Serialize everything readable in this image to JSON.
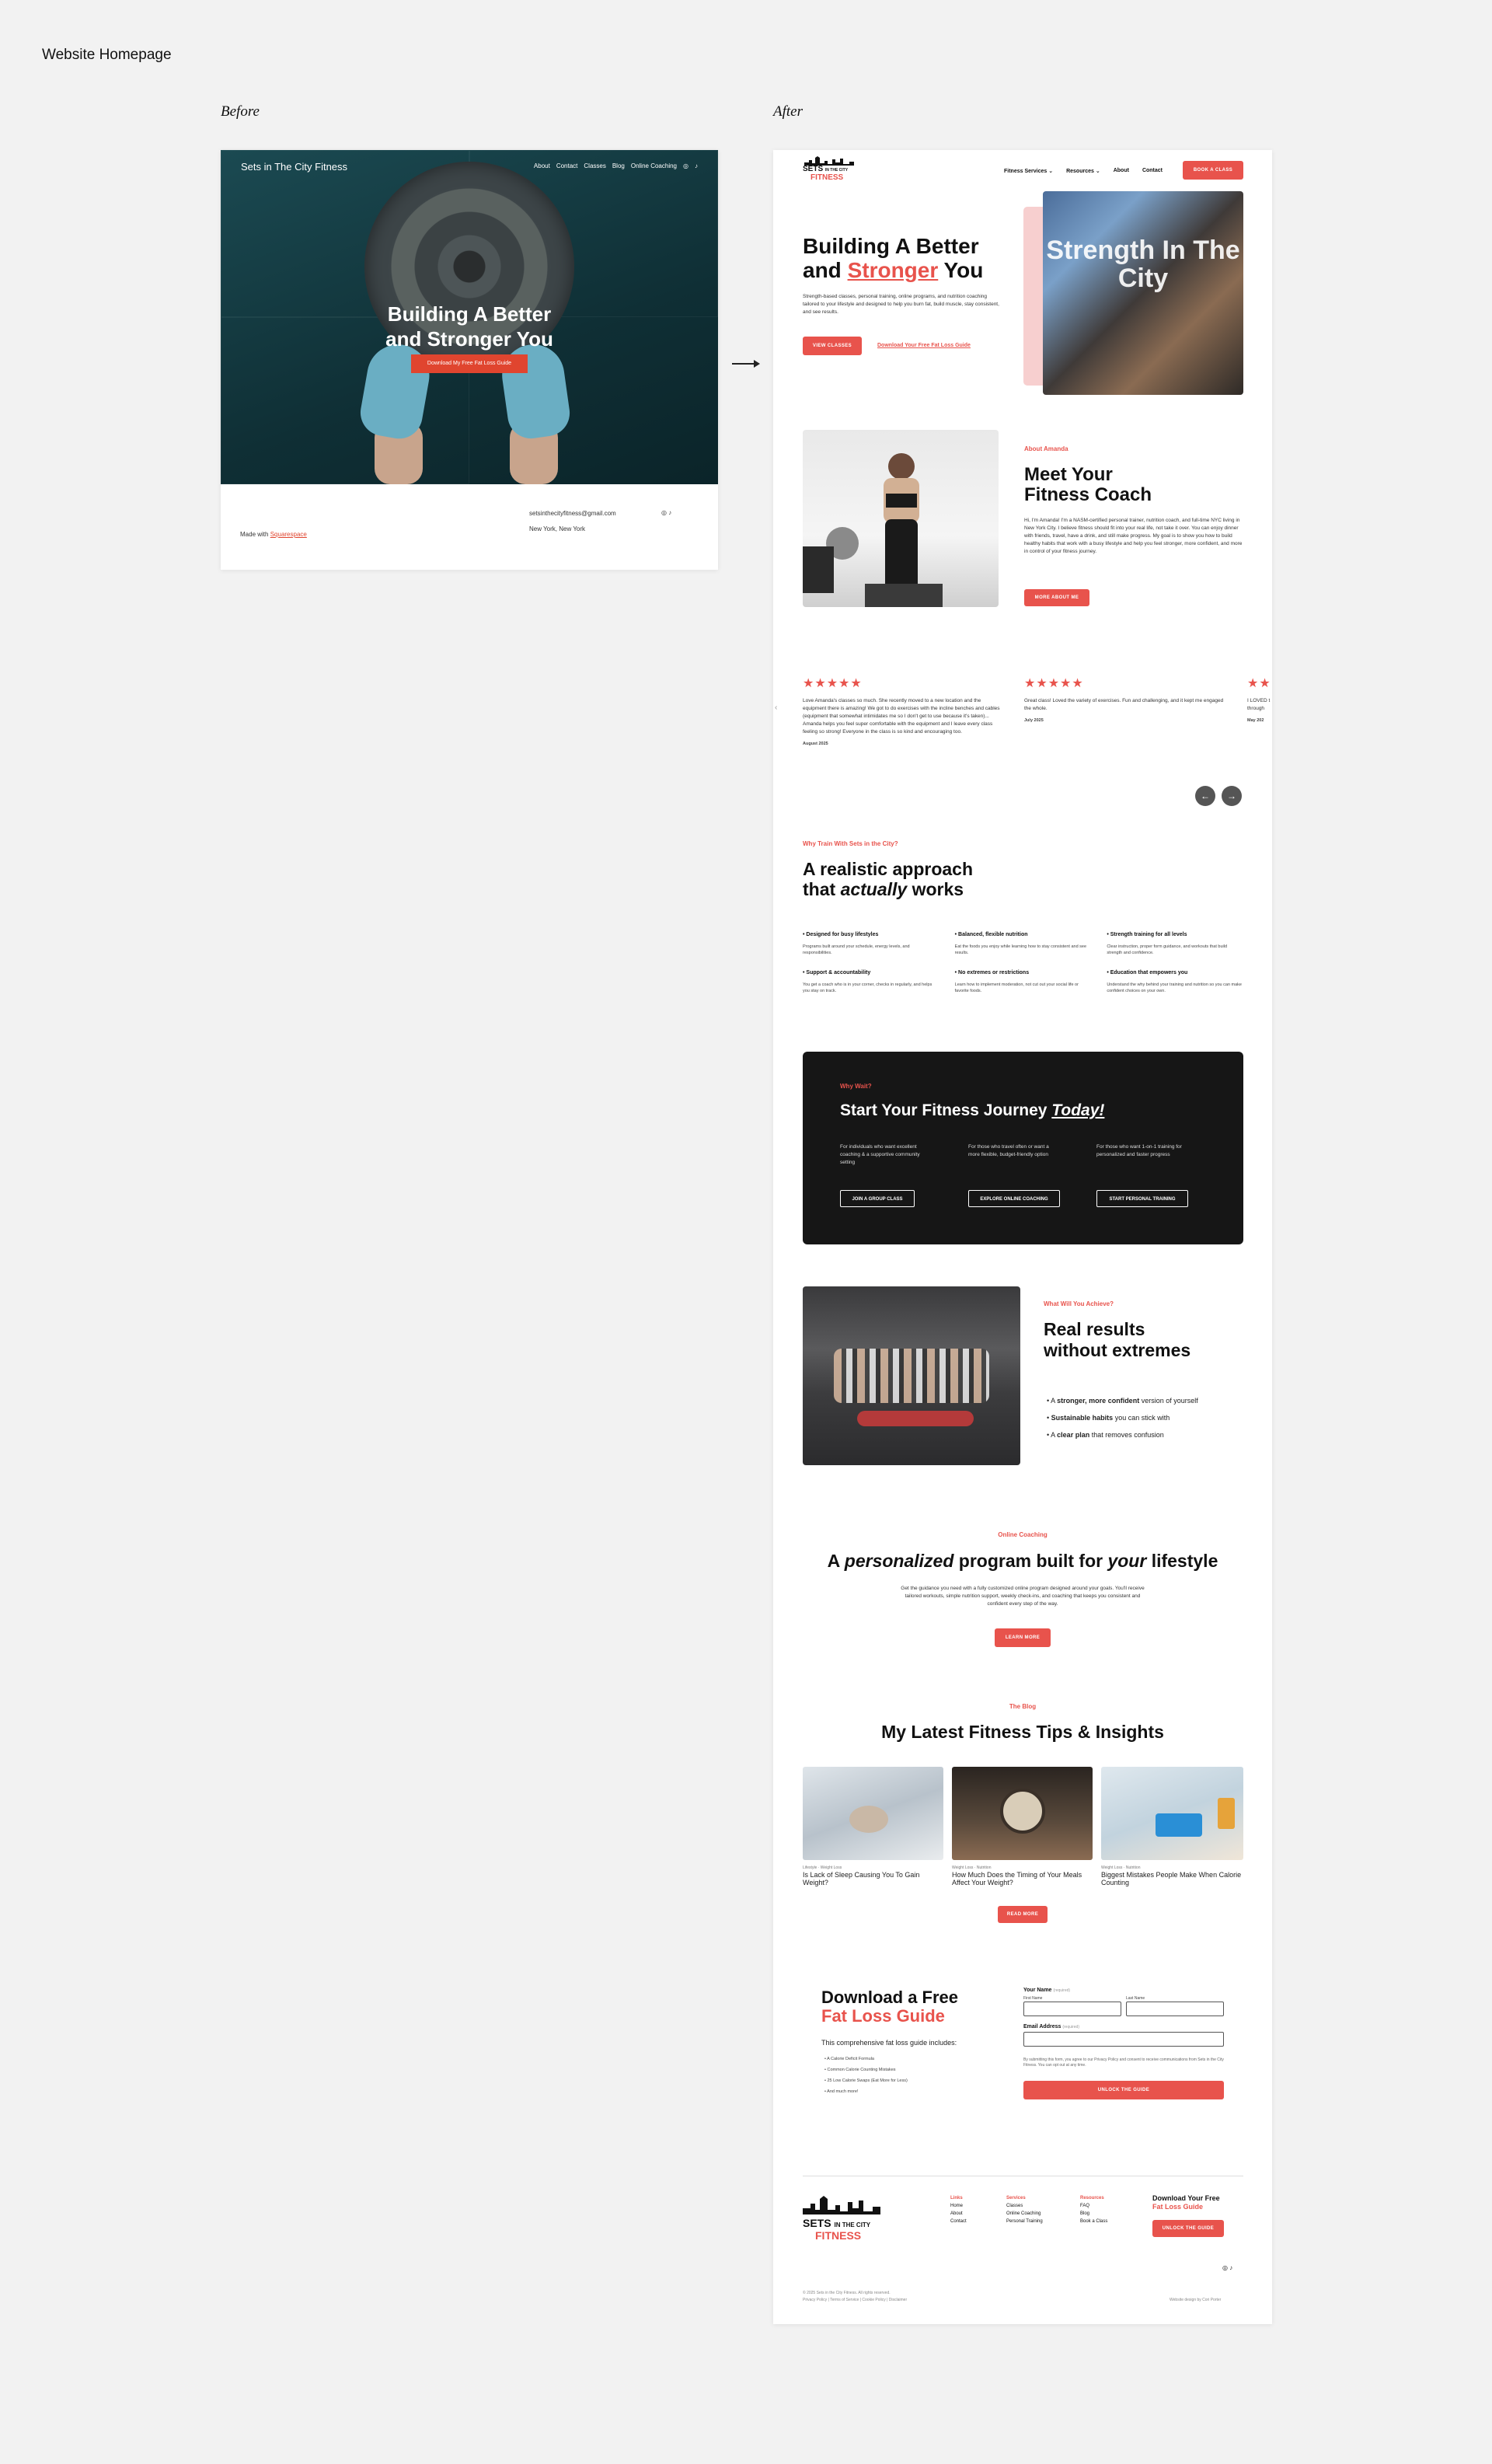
{
  "page_title": "Website Homepage",
  "labels": {
    "before": "Before",
    "after": "After"
  },
  "before": {
    "site_title": "Sets in The City Fitness",
    "nav": [
      "About",
      "Contact",
      "Classes",
      "Blog",
      "Online Coaching"
    ],
    "headline": "Building A Better and Stronger You",
    "cta": "Download My Free Fat Loss Guide",
    "email": "setsinthecityfitness@gmail.com",
    "location": "New York, New York",
    "made_with_prefix": "Made with",
    "made_with_link": "Squarespace"
  },
  "after": {
    "logo": {
      "line1": "SETS",
      "mid": "IN THE CITY",
      "line2": "FITNESS"
    },
    "nav": {
      "items": [
        "Fitness Services",
        "Resources",
        "About",
        "Contact"
      ],
      "cta": "BOOK A CLASS"
    },
    "hero": {
      "headline_1": "Building A Better",
      "headline_2_pre": "and",
      "headline_2_accent": "Stronger",
      "headline_2_post": "You",
      "body": "Strength-based classes, personal training, online programs, and nutrition coaching tailored to your lifestyle and designed to help you burn fat, build muscle, stay consistent, and see results.",
      "cta_primary": "VIEW CLASSES",
      "cta_link": "Download Your Free Fat Loss Guide",
      "image_text": "Strength In The City"
    },
    "about": {
      "eyebrow": "About Amanda",
      "title_1": "Meet Your",
      "title_2": "Fitness Coach",
      "body": "Hi, I'm Amanda! I'm a NASM-certified personal trainer, nutrition coach, and full-time NYC living in New York City. I believe fitness should fit into your real life, not take it over. You can enjoy dinner with friends, travel, have a drink, and still make progress. My goal is to show you how to build healthy habits that work with a busy lifestyle and help you feel stronger, more confident, and more in control of your fitness journey.",
      "cta": "MORE ABOUT ME"
    },
    "testimonials": [
      {
        "stars": "★★★★★",
        "text": "Love Amanda's classes so much. She recently moved to a new location and the equipment there is amazing! We got to do exercises with the incline benches and cables (equipment that somewhat intimidates me so I don't get to use because it's taken)... Amanda helps you feel super comfortable with the equipment and I leave every class feeling so strong! Everyone in the class is so kind and encouraging too.",
        "date": "August 2025"
      },
      {
        "stars": "★★★★★",
        "text": "Great class! Loved the variety of exercises. Fun and challenging, and it kept me engaged the whole.",
        "date": "July 2025"
      },
      {
        "stars": "★★★",
        "text": "I LOVED t through",
        "date": "May 202"
      }
    ],
    "approach": {
      "eyebrow": "Why Train With Sets in the City?",
      "title_1": "A realistic approach",
      "title_2_pre": "that",
      "title_2_em": "actually",
      "title_2_post": "works",
      "features": [
        {
          "title": "• Designed for busy lifestyles",
          "text": "Programs built around your schedule, energy levels, and responsibilities."
        },
        {
          "title": "• Balanced, flexible nutrition",
          "text": "Eat the foods you enjoy while learning how to stay consistent and see results."
        },
        {
          "title": "• Strength training for all levels",
          "text": "Clear instruction, proper form guidance, and workouts that build strength and confidence."
        },
        {
          "title": "• Support & accountability",
          "text": "You get a coach who is in your corner, checks in regularly, and helps you stay on track."
        },
        {
          "title": "• No extremes or restrictions",
          "text": "Learn how to implement moderation, not cut out your social life or favorite foods."
        },
        {
          "title": "• Education that empowers you",
          "text": "Understand the why behind your training and nutrition so you can make confident choices on your own."
        }
      ]
    },
    "journey": {
      "eyebrow": "Why Wait?",
      "title_pre": "Start Your Fitness Journey",
      "title_accent": "Today!",
      "options": [
        {
          "text": "For individuals who want excellent coaching & a supportive community setting",
          "cta": "JOIN A GROUP CLASS"
        },
        {
          "text": "For those who travel often or want a more flexible, budget-friendly option",
          "cta": "EXPLORE ONLINE COACHING"
        },
        {
          "text": "For those who want 1-on-1 training for personalized and faster progress",
          "cta": "START PERSONAL TRAINING"
        }
      ]
    },
    "results": {
      "eyebrow": "What Will You Achieve?",
      "title_1": "Real results",
      "title_2": "without extremes",
      "bullets": [
        {
          "pre": "A ",
          "bold": "stronger, more confident",
          "post": " version of yourself"
        },
        {
          "pre": "",
          "bold": "Sustainable habits",
          "post": " you can stick with"
        },
        {
          "pre": "A ",
          "bold": "clear plan",
          "post": " that removes confusion"
        }
      ]
    },
    "online": {
      "eyebrow": "Online Coaching",
      "title_a": "A",
      "title_em1": "personalized",
      "title_b": "program built for",
      "title_em2": "your",
      "title_c": "lifestyle",
      "body": "Get the guidance you need with a fully customized online program designed around your goals. You'll receive tailored workouts, simple nutrition support, weekly check-ins, and coaching that keeps you consistent and confident every step of the way.",
      "cta": "LEARN MORE"
    },
    "blog": {
      "eyebrow": "The Blog",
      "title": "My Latest Fitness Tips & Insights",
      "posts": [
        {
          "meta": "Lifestyle · Weight Loss",
          "title": "Is Lack of Sleep Causing You To Gain Weight?"
        },
        {
          "meta": "Weight Loss · Nutrition",
          "title": "How Much Does the Timing of Your Meals Affect Your Weight?"
        },
        {
          "meta": "Weight Loss · Nutrition",
          "title": "Biggest Mistakes People Make When Calorie Counting"
        }
      ],
      "cta": "READ MORE"
    },
    "guide": {
      "title_1": "Download a Free",
      "title_2": "Fat Loss Guide",
      "intro": "This comprehensive fat loss guide includes:",
      "items": [
        "A Calorie Deficit Formula",
        "Common Calorie Counting Mistakes",
        "25 Low Calorie Swaps (Eat More for Less)",
        "And much more!"
      ],
      "form": {
        "name_label": "Your Name",
        "required": "(required)",
        "first": "First Name",
        "last": "Last Name",
        "email_label": "Email Address",
        "consent": "By submitting this form, you agree to our Privacy Policy and consent to receive communications from Sets in the City Fitness. You can opt out at any time.",
        "submit": "UNLOCK THE GUIDE"
      }
    },
    "footer": {
      "cols": [
        {
          "title": "Links",
          "items": [
            "Home",
            "About",
            "Contact"
          ]
        },
        {
          "title": "Services",
          "items": [
            "Classes",
            "Online Coaching",
            "Personal Training"
          ]
        },
        {
          "title": "Resources",
          "items": [
            "FAQ",
            "Blog",
            "Book a Class"
          ]
        }
      ],
      "cta_title_1": "Download Your Free",
      "cta_title_2": "Fat Loss Guide",
      "cta_button": "UNLOCK THE GUIDE",
      "copyright": "© 2025 Sets in the City Fitness. All rights reserved.",
      "legal": "Privacy Policy  |  Terms of Service  |  Cookie Policy  |  Disclaimer",
      "credit": "Website design by Cori Porter"
    }
  },
  "colors": {
    "accent": "#e8534c",
    "dark": "#111111"
  }
}
